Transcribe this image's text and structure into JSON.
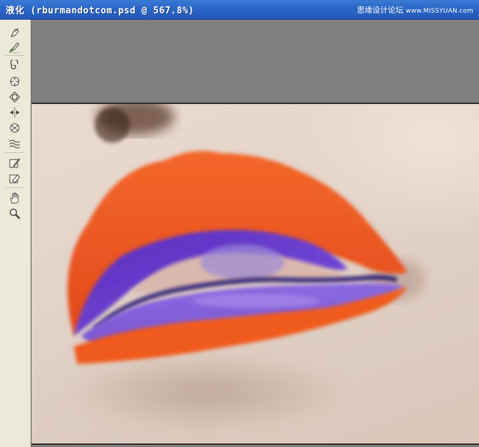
{
  "window": {
    "title": "液化 (rburmandotcom.psd @ 567.8%)",
    "watermark_cn": "思缘设计论坛",
    "watermark_url": "www.MISSYUAN.com"
  },
  "tools": [
    {
      "name": "forward-warp-tool",
      "icon": "finger-push-icon"
    },
    {
      "name": "reconstruct-tool",
      "icon": "brush-reconstruct-icon"
    },
    {
      "name": "twirl-clockwise-tool",
      "icon": "twirl-icon"
    },
    {
      "name": "pucker-tool",
      "icon": "pucker-icon"
    },
    {
      "name": "bloat-tool",
      "icon": "bloat-icon"
    },
    {
      "name": "push-left-tool",
      "icon": "push-left-icon"
    },
    {
      "name": "mirror-tool",
      "icon": "mirror-icon"
    },
    {
      "name": "turbulence-tool",
      "icon": "turbulence-icon"
    },
    {
      "name": "freeze-mask-tool",
      "icon": "freeze-mask-icon"
    },
    {
      "name": "thaw-mask-tool",
      "icon": "thaw-mask-icon"
    },
    {
      "name": "hand-tool",
      "icon": "hand-icon"
    },
    {
      "name": "zoom-tool",
      "icon": "magnifier-icon"
    }
  ],
  "colors": {
    "titlebar": "#2b66c6",
    "panel": "#ece9d8",
    "canvas_bg": "#808080",
    "lip_orange": "#f05a1e",
    "lip_purple": "#6a3fd0"
  }
}
